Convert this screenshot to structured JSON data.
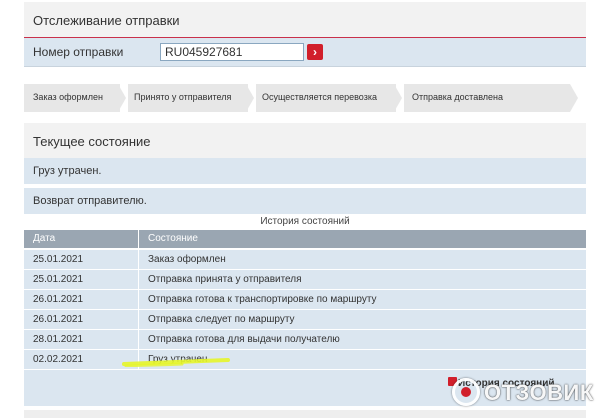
{
  "tracking": {
    "title": "Отслеживание отправки",
    "number_label": "Номер отправки",
    "number_value": "RU045927681",
    "go_icon": "arrow-right-icon"
  },
  "steps": [
    {
      "label": "Заказ оформлен"
    },
    {
      "label": "Принято у отправителя"
    },
    {
      "label": "Осуществляется перевозка"
    },
    {
      "label": "Отправка доставлена"
    }
  ],
  "current": {
    "title": "Текущее состояние",
    "status": "Груз утрачен.",
    "action": "Возврат отправителю."
  },
  "history": {
    "caption": "История состояний",
    "columns": [
      "Дата",
      "Состояние"
    ],
    "rows": [
      {
        "date": "25.01.2021",
        "state": "Заказ оформлен"
      },
      {
        "date": "25.01.2021",
        "state": "Отправка принята у отправителя"
      },
      {
        "date": "26.01.2021",
        "state": "Отправка готова к транспортировке по маршруту"
      },
      {
        "date": "26.01.2021",
        "state": "Отправка следует по маршруту"
      },
      {
        "date": "28.01.2021",
        "state": "Отправка готова для выдачи получателю"
      },
      {
        "date": "02.02.2021",
        "state": "Груз утрачен"
      }
    ],
    "link_label": "История состояний"
  },
  "watermark": {
    "text": "ОТЗОВИК"
  },
  "colors": {
    "accent": "#c9304a",
    "button": "#d11f2b",
    "row_bg": "#dbe6f0",
    "header_bg": "#9aa6b2",
    "highlight": "#e6f52a"
  }
}
